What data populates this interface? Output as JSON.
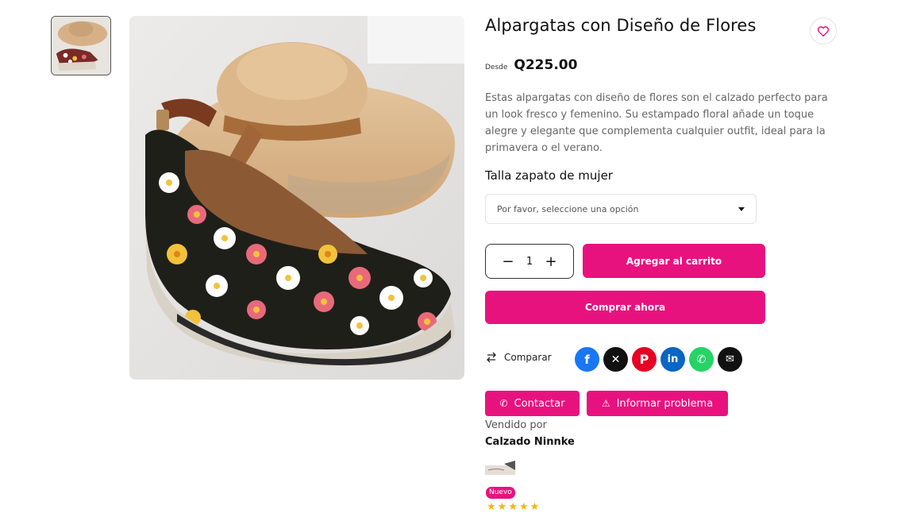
{
  "product": {
    "title": "Alpargatas con Diseño de Flores",
    "price_prefix": "Desde",
    "price": "Q225.00",
    "description": "Estas alpargatas con diseño de flores son el calzado perfecto para un look fresco y femenino. Su estampado floral añade un toque alegre y elegante que complementa cualquier outfit, ideal para la primavera o el verano.",
    "variant_label": "Talla zapato de mujer",
    "variant_placeholder": "Por favor, seleccione una opción",
    "quantity": "1"
  },
  "actions": {
    "add_to_cart": "Agregar al carrito",
    "buy_now": "Comprar ahora",
    "compare": "Comparar",
    "contact": "Contactar",
    "report": "Informar problema"
  },
  "vendor": {
    "sold_by_label": "Vendido por",
    "name": "Calzado Ninnke",
    "badge": "Nuevo",
    "rating": 5
  },
  "social": [
    {
      "name": "facebook-icon",
      "color": "#1877f2",
      "glyph": "f"
    },
    {
      "name": "x-icon",
      "color": "#111111",
      "glyph": "𝕏"
    },
    {
      "name": "pinterest-icon",
      "color": "#e60023",
      "glyph": "P"
    },
    {
      "name": "linkedin-icon",
      "color": "#0a66c2",
      "glyph": "in"
    },
    {
      "name": "whatsapp-icon",
      "color": "#25d366",
      "glyph": "✆"
    },
    {
      "name": "email-icon",
      "color": "#111111",
      "glyph": "✉"
    }
  ],
  "colors": {
    "accent": "#e8127f",
    "star": "#f5b50a"
  }
}
